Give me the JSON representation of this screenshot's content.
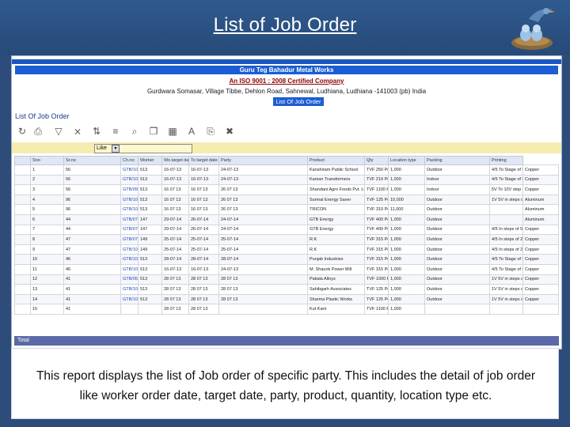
{
  "slide": {
    "title": "List of Job Order",
    "caption": "This report displays the list of Job order of specific party. This includes the detail of job order like worker order date, target date, party, product, quantity, location type etc."
  },
  "report": {
    "company_name": "Guru Teg Bahadur Metal Works",
    "iso": "An ISO 9001 : 2008 Certified Company",
    "address": "Gurdwara Somasar, Village Tibbe, Dehlon Road, Sahnewal, Ludhiana, Ludhiana -141003 (pb) India",
    "report_button": "List Of Job Order",
    "list_title": "List Of Job Order",
    "filter_value": "Like",
    "total_label": "Total"
  },
  "toolbar": {
    "icons": [
      "refresh-icon",
      "print-icon",
      "filter-icon",
      "clear-filter-icon",
      "sort-icon",
      "group-icon",
      "search-icon",
      "export-icon",
      "chart-icon",
      "text-icon",
      "copy-icon",
      "cancel-icon"
    ],
    "colors": {
      "brand": "#1b5dd3",
      "slide_bg": "#2d4c7a",
      "total_bar": "#5b6aa6",
      "filter_bg": "#f6ecb0"
    }
  },
  "table": {
    "columns": [
      "Sno",
      "Sr.no",
      "Ch.no",
      "Worker",
      "Wo.target date",
      "To target date",
      "Party",
      "Product",
      "Qty",
      "Location type",
      "Packing",
      "Printing"
    ],
    "rows": [
      [
        "1",
        "56",
        "GTB/10/13/423",
        "513",
        "16-07-13",
        "16-07-13",
        "24-07-13",
        "Kanshiram Public School",
        "TVF 250 Pcs",
        "1,000",
        "Outdoor",
        "4/5 To Stage of 5.5R",
        "Copper"
      ],
      [
        "2",
        "56",
        "GTB/10/13/423",
        "513",
        "16-07-13",
        "16-07-13",
        "24-07-13",
        "Kaman Transformers",
        "TVF 210 Pcs",
        "1,000",
        "Indoor",
        "4/5 To Stage of 5.5R",
        "Copper"
      ],
      [
        "3",
        "56",
        "GTB/09/2016/347",
        "513",
        "16 07 13",
        "16 07 13",
        "26 07 13",
        "Shandani Agro Foods Pvt. Ltd.",
        "TVF 1100 Pcs",
        "1,000",
        "Indoor",
        "5V To 10V step 1.5R",
        "Copper"
      ],
      [
        "4",
        "96",
        "GTB/10/13/365",
        "513",
        "16 07 13",
        "16 07 13",
        "26 07 13",
        "Surmal Energy Saver",
        "TVF 125 Pcs",
        "10,000",
        "Outdoor",
        "1V 5V in steps of 2.5R",
        "Aluminum"
      ],
      [
        "5",
        "96",
        "GTB/10/13/365",
        "513",
        "16 07 13",
        "16 07 13",
        "26 07 13",
        "TRICON",
        "TVF 310 Pcs",
        "11,000",
        "Outdoor",
        "",
        "Aluminum"
      ],
      [
        "6",
        "44",
        "GTB/07/2016/347",
        "147",
        "29-07-14",
        "26-07-14",
        "24-07-14",
        "GTB Energy",
        "TVF 400 Pcs 31",
        "1,000",
        "Outdoor",
        "",
        "Aluminum"
      ],
      [
        "7",
        "44",
        "GTB/07/2016/341",
        "147",
        "29-07-14",
        "26-07-14",
        "24-07-14",
        "GTB Energy",
        "TVF 400 Pcs",
        "1,000",
        "Outdoor",
        "4/5 In steps of 5.5R",
        "Copper"
      ],
      [
        "8",
        "47",
        "GTB/07/2016/349",
        "149",
        "25-07-14",
        "25-07-14",
        "25-07-14",
        "R.K",
        "TVF 315 Pcs",
        "1,000",
        "Outdoor",
        "4/5 In steps of 2.5R",
        "Copper"
      ],
      [
        "9",
        "47",
        "GTB/10/2016/351",
        "149",
        "25-07-14",
        "25-07-14",
        "25-07-14",
        "R.K",
        "TVF 315 Pcs",
        "1,000",
        "Outdoor",
        "4/5 In steps of 2.5R",
        "Copper"
      ],
      [
        "10",
        "46",
        "GTB/10/2016/352",
        "513",
        "28-07-14",
        "28-07-14",
        "28-07-14",
        "Punjab Industries",
        "TVF 315 Pcs",
        "1,000",
        "Outdoor",
        "4/5 To Stage of 5.5R",
        "Copper"
      ],
      [
        "11",
        "46",
        "GTB/10/13/443",
        "513",
        "16-07-13",
        "16-07-13",
        "24-07-13",
        "M. Shaunk Power Mill",
        "TVF 315 Pcs",
        "1,000",
        "Outdoor",
        "4/5 To Stage of 5.5R",
        "Copper"
      ],
      [
        "12",
        "41",
        "GTB/05/2016/311",
        "513",
        "28 07 13",
        "28 07 13",
        "28 07 13",
        "Patiala Alloys",
        "TVF 1000 Pcs",
        "1,000",
        "Outdoor",
        "1V 5V in steps of 2.5R",
        "Copper"
      ],
      [
        "13",
        "41",
        "GTB/10/13/443",
        "513",
        "28 07 13",
        "28 07 13",
        "28 07 13",
        "Sahibgarh Associates",
        "TVF 125 Pcs",
        "1,000",
        "Outdoor",
        "1V 5V in steps of 2.5R",
        "Copper"
      ],
      [
        "14",
        "41",
        "GTB/10/13/443",
        "513",
        "28 07 13",
        "28 07 13",
        "28 07 13",
        "Sharma Plastic Works",
        "TVF 125 Pcs",
        "1,000",
        "Outdoor",
        "1V 5V in steps of 2.5R",
        "Copper"
      ],
      [
        "15",
        "41",
        "",
        "",
        "28 07 13",
        "28 07 13",
        "",
        "Kut Kant",
        "TVF 1100 Pcs",
        "1,000",
        "",
        "",
        ""
      ]
    ]
  }
}
